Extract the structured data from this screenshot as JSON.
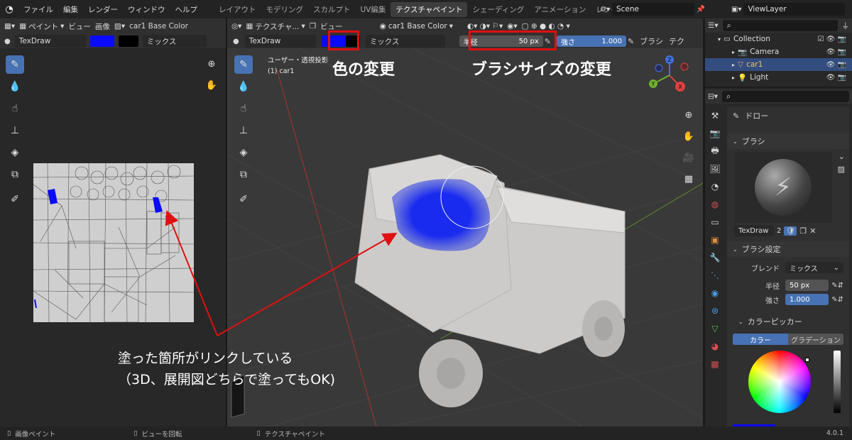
{
  "topbar": {
    "menus": [
      "ファイル",
      "編集",
      "レンダー",
      "ウィンドウ",
      "ヘルプ"
    ],
    "workspaces": [
      "レイアウト",
      "モデリング",
      "スカルプト",
      "UV編集",
      "テクスチャペイント",
      "シェーディング",
      "アニメーション",
      "レンダ"
    ],
    "active_workspace": "テクスチャペイント",
    "scene": "Scene",
    "view_layer": "ViewLayer"
  },
  "image_editor": {
    "mode": "ペイント",
    "view_menu": "ビュー",
    "image_menu": "画像",
    "image_name": "car1 Base Color",
    "brush_name": "TexDraw",
    "blend": "ミックス"
  },
  "viewport": {
    "mode": "テクスチャ...",
    "view_menu": "ビュー",
    "texture_slot": "car1 Base Color",
    "brush_name": "TexDraw",
    "blend": "ミックス",
    "radius_label": "半径",
    "radius_value": "50 px",
    "strength_label": "強さ",
    "strength_value": "1.000",
    "brush_menu": "ブラシ",
    "texture_menu": "テク",
    "view_info_1": "ユーザー・透視投影",
    "view_info_2": "(1) car1",
    "gizmo": {
      "x": "X",
      "y": "Y",
      "z": "Z"
    }
  },
  "annotations": {
    "color_change": "色の変更",
    "brush_size_change": "ブラシサイズの変更",
    "linked_line1": "塗った箇所がリンクしている",
    "linked_line2": "（3D、展開図どちらで塗ってもOK)"
  },
  "outliner": {
    "items": [
      {
        "name": "Collection",
        "icon": "collection-icon"
      },
      {
        "name": "Camera",
        "icon": "camera-icon"
      },
      {
        "name": "car1",
        "icon": "mesh-icon"
      },
      {
        "name": "Light",
        "icon": "light-icon"
      }
    ]
  },
  "properties": {
    "tool_name": "ドロー",
    "brush_section": "ブラシ",
    "brush_name": "TexDraw",
    "brush_users": "2",
    "brush_settings_section": "ブラシ設定",
    "blend_label": "ブレンド",
    "blend_value": "ミックス",
    "radius_label": "半径",
    "radius_value": "50 px",
    "strength_label": "強さ",
    "strength_value": "1.000",
    "color_picker_section": "カラーピッカー",
    "tab_color": "カラー",
    "tab_gradient": "グラデーション"
  },
  "statusbar": {
    "left": "画像ペイント",
    "middle": "ビューを回転",
    "right": "テクスチャペイント",
    "version": "4.0.1"
  },
  "colors": {
    "paint_color": "#0a0aff",
    "accent": "#4772b3",
    "annotation_red": "#e01010"
  }
}
